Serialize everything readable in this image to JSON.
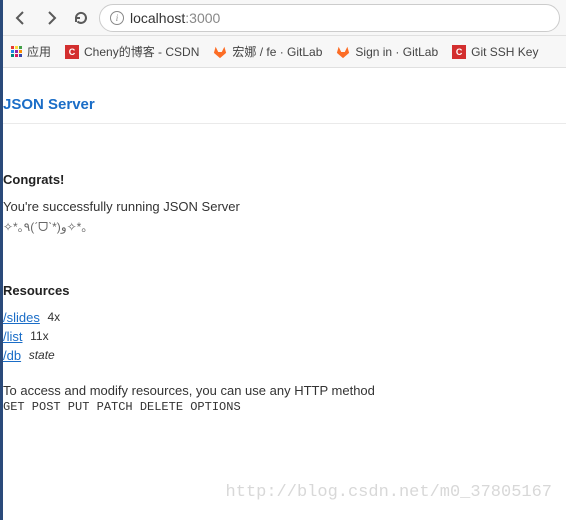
{
  "toolbar": {
    "url_host": "localhost",
    "url_port": ":3000"
  },
  "bookmarks": {
    "apps_label": "应用",
    "items": [
      {
        "label": "Cheny的博客 - CSDN",
        "icon": "csdn"
      },
      {
        "label": "宏娜 / fe · GitLab",
        "icon": "gitlab"
      },
      {
        "label": "Sign in · GitLab",
        "icon": "gitlab"
      },
      {
        "label": "Git SSH Key",
        "icon": "csdn"
      }
    ]
  },
  "page": {
    "title": "JSON Server",
    "congrats_heading": "Congrats!",
    "congrats_msg": "You're successfully running JSON Server",
    "kaomoji": "✧*｡٩(ˊᗜˋ*)و✧*｡",
    "resources_heading": "Resources",
    "resources": [
      {
        "path": "/slides",
        "count": "4x"
      },
      {
        "path": "/list",
        "count": "11x"
      },
      {
        "path": "/db",
        "count": "state"
      }
    ],
    "access_note": "To access and modify resources, you can use any HTTP method",
    "methods": "GET POST PUT PATCH DELETE OPTIONS"
  },
  "watermark": "http://blog.csdn.net/m0_37805167"
}
